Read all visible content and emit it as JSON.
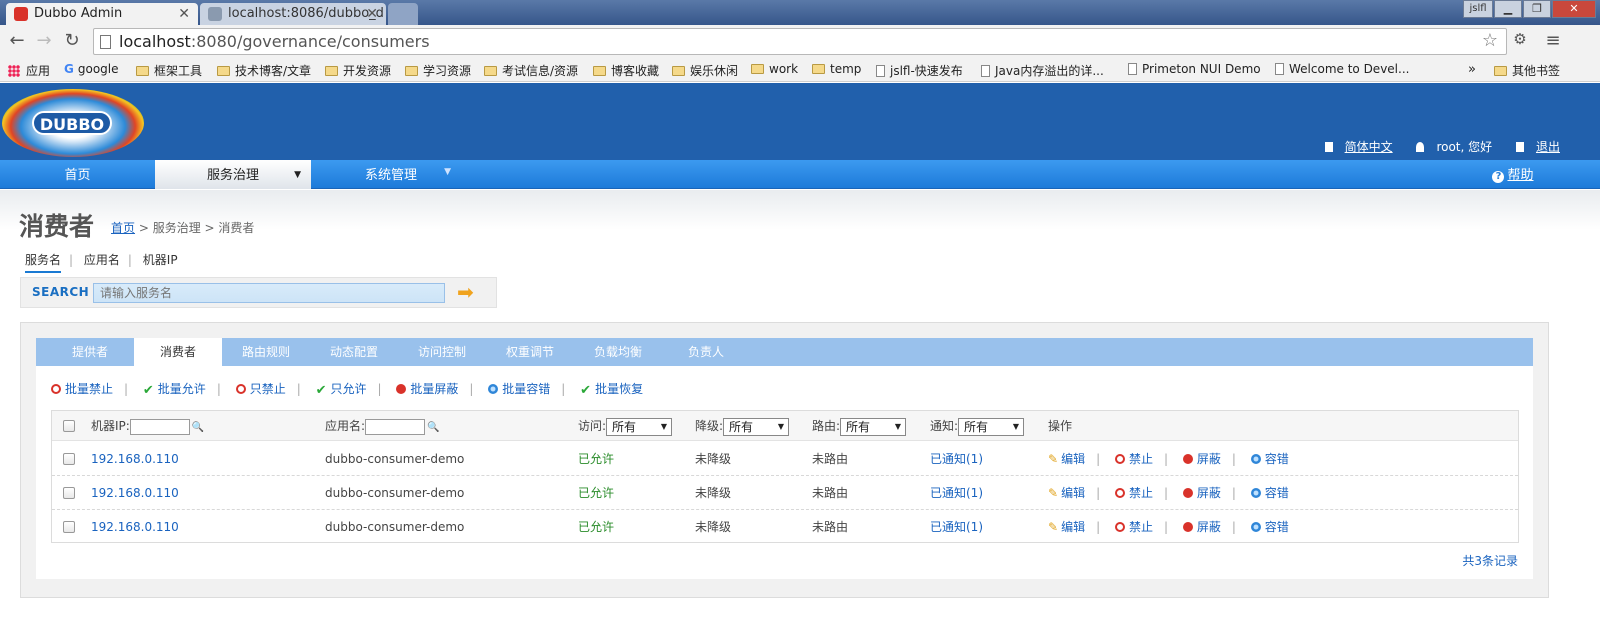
{
  "browser": {
    "tabs": [
      {
        "title": "Dubbo Admin",
        "active": true
      },
      {
        "title": "localhost:8086/dubbo_d",
        "active": false
      }
    ],
    "user_badge": "jslfl",
    "url_host": "localhost",
    "url_rest": ":8080/governance/consumers",
    "bookmarks": [
      "应用",
      "google",
      "框架工具",
      "技术博客/文章",
      "开发资源",
      "学习资源",
      "考试信息/资源",
      "博客收藏",
      "娱乐休闲",
      "work",
      "temp",
      "jslfl-快速发布",
      "Java内存溢出的详...",
      "Primeton NUI Demo",
      "Welcome to Devel..."
    ],
    "bookmarks_more": "»",
    "bookmarks_other": "其他书签"
  },
  "header": {
    "logo_text": "DUBBO",
    "lang": "简体中文",
    "greeting": "root, 您好",
    "logout": "退出"
  },
  "nav": {
    "home": "首页",
    "governance": "服务治理",
    "system": "系统管理",
    "help": "帮助"
  },
  "page": {
    "title": "消费者",
    "crumb_home": "首页",
    "crumb_rest": " > 服务治理 > 消费者"
  },
  "search": {
    "tabs": [
      "服务名",
      "应用名",
      "机器IP"
    ],
    "label": "SEARCH",
    "placeholder": "请输入服务名"
  },
  "content_tabs": [
    "提供者",
    "消费者",
    "路由规则",
    "动态配置",
    "访问控制",
    "权重调节",
    "负载均衡",
    "负责人"
  ],
  "actions": [
    "批量禁止",
    "批量允许",
    "只禁止",
    "只允许",
    "批量屏蔽",
    "批量容错",
    "批量恢复"
  ],
  "table": {
    "headers": {
      "ip": "机器IP:",
      "app": "应用名:",
      "access": "访问:",
      "degrade": "降级:",
      "route": "路由:",
      "notify": "通知:",
      "ops": "操作"
    },
    "filter_all": "所有",
    "rows": [
      {
        "ip": "192.168.0.110",
        "app": "dubbo-consumer-demo",
        "access": "已允许",
        "degrade": "未降级",
        "route": "未路由",
        "notify": "已通知(1)"
      },
      {
        "ip": "192.168.0.110",
        "app": "dubbo-consumer-demo",
        "access": "已允许",
        "degrade": "未降级",
        "route": "未路由",
        "notify": "已通知(1)"
      },
      {
        "ip": "192.168.0.110",
        "app": "dubbo-consumer-demo",
        "access": "已允许",
        "degrade": "未降级",
        "route": "未路由",
        "notify": "已通知(1)"
      }
    ],
    "row_ops": [
      "编辑",
      "禁止",
      "屏蔽",
      "容错"
    ]
  },
  "footer": "共3条记录"
}
